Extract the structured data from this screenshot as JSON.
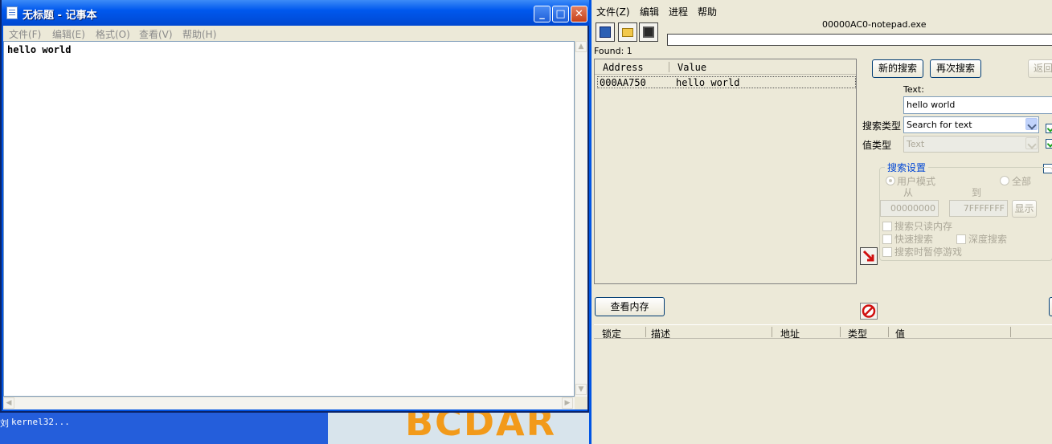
{
  "notepad": {
    "title": "无标题 - 记事本",
    "menu": [
      "文件(F)",
      "编辑(E)",
      "格式(O)",
      "查看(V)",
      "帮助(H)"
    ],
    "content": "hello world",
    "controls": {
      "minimize": "_",
      "maximize": "□",
      "close": "✕"
    }
  },
  "desktop": {
    "taskbar_text": "kernel32...",
    "partial_prefix": "刘",
    "logo_text": "BCDAR"
  },
  "cheat_engine": {
    "menu": [
      "文件(Z)",
      "编辑",
      "进程",
      "帮助"
    ],
    "process": "00000AC0-notepad.exe",
    "found": "Found: 1",
    "columns": {
      "address": "Address",
      "value": "Value"
    },
    "results": [
      {
        "address": "000AA750",
        "value": "hello world"
      }
    ],
    "buttons": {
      "new_scan": "新的搜索",
      "next_scan": "再次搜索",
      "undo": "返回",
      "view_memory": "查看内存",
      "show": "显示"
    },
    "text_label": "Text:",
    "text_value": "hello world",
    "scan_type_label": "搜索类型",
    "scan_type_value": "Search for text",
    "value_type_label": "值类型",
    "value_type_value": "Text",
    "group_title": "搜索设置",
    "user_mode": "用户模式",
    "all": "全部",
    "from_label": "从",
    "to_label": "到",
    "from_value": "00000000",
    "to_value": "7FFFFFFF",
    "opt_readonly": "搜索只读内存",
    "opt_fast": "快速搜索",
    "opt_deep": "深度搜索",
    "opt_pause": "搜索时暂停游戏",
    "bottom_columns": [
      "锁定",
      "描述",
      "地址",
      "类型",
      "值"
    ]
  }
}
